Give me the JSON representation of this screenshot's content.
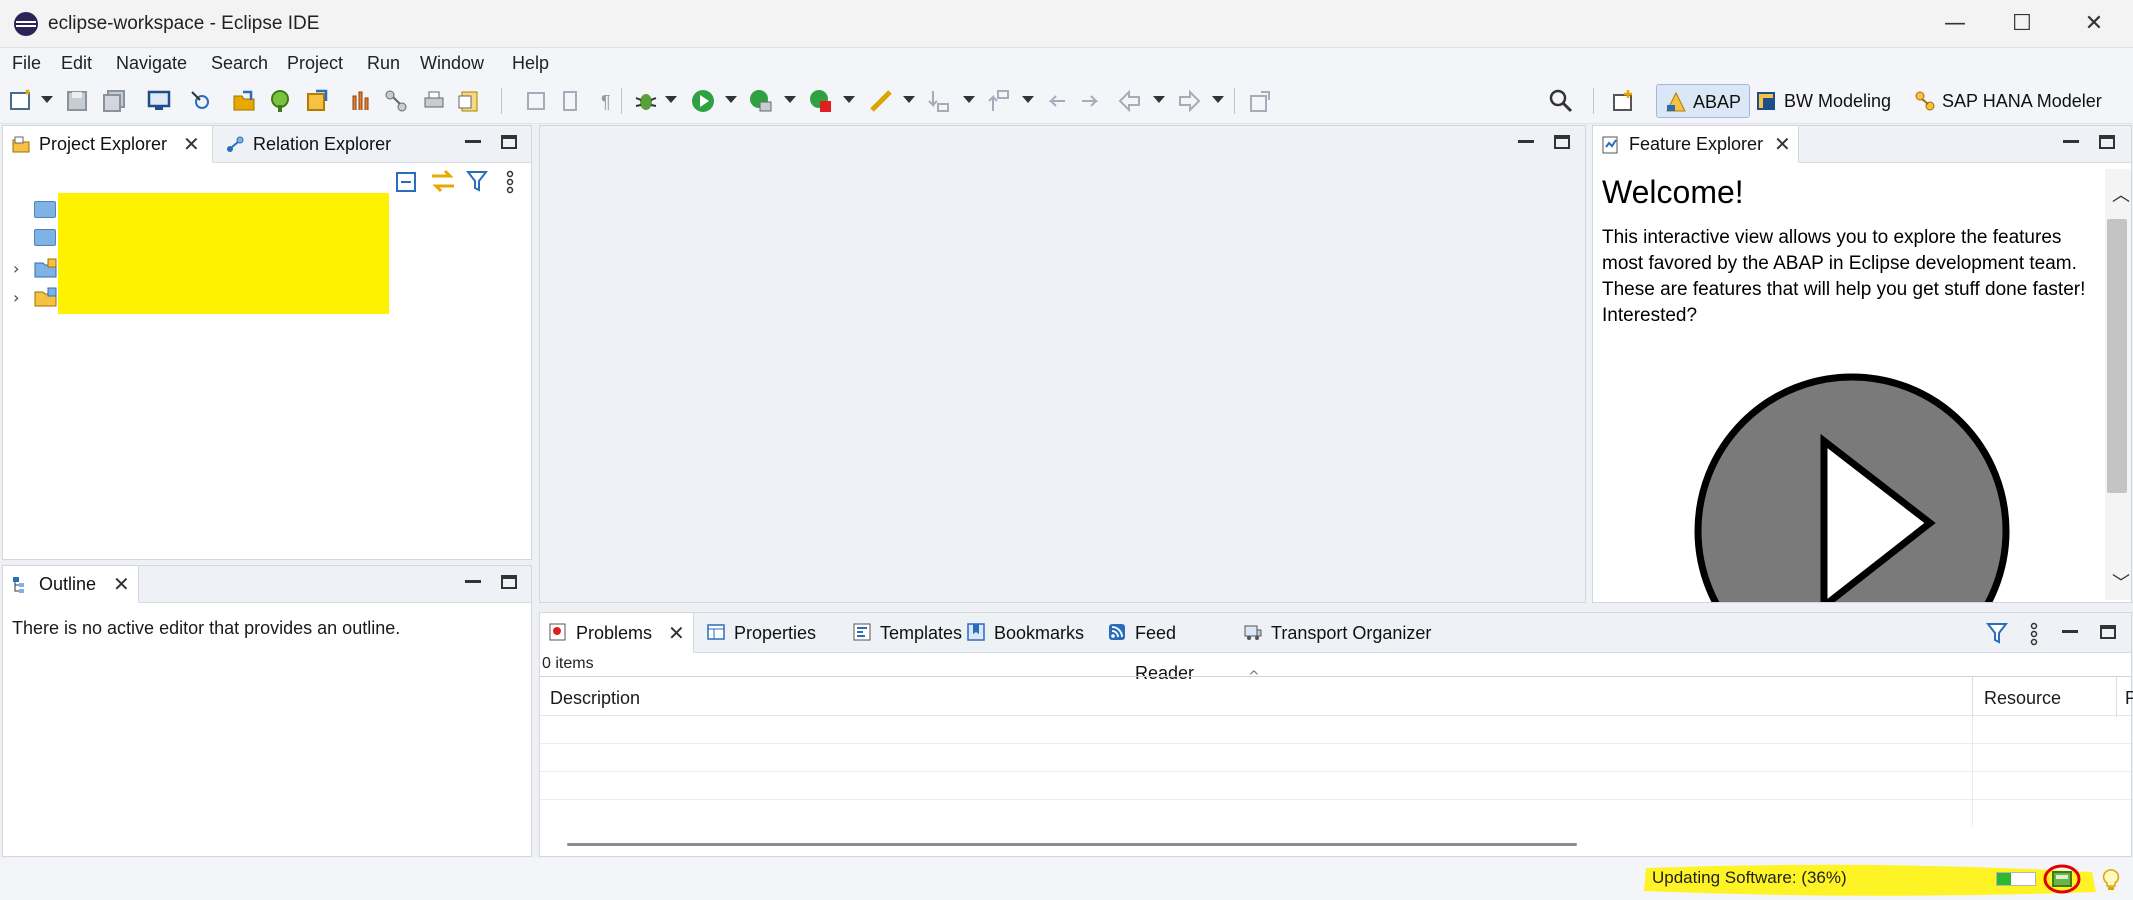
{
  "window": {
    "title": "eclipse-workspace - Eclipse IDE",
    "minimize": "—",
    "maximize": "☐",
    "close": "✕"
  },
  "menu": [
    "File",
    "Edit",
    "Navigate",
    "Search",
    "Project",
    "Run",
    "Window",
    "Help"
  ],
  "perspectives": [
    "ABAP",
    "BW Modeling",
    "SAP HANA Modeler"
  ],
  "project_explorer": {
    "tabs": [
      "Project Explorer",
      "Relation Explorer"
    ]
  },
  "outline": {
    "tab": "Outline",
    "message": "There is no active editor that provides an outline."
  },
  "feature_explorer": {
    "tab": "Feature Explorer",
    "heading": "Welcome!",
    "body": "This interactive view allows you to explore the features most favored by the ABAP in Eclipse development team. These are features that will help you get stuff done faster! Interested?"
  },
  "bottom": {
    "tabs": [
      "Problems",
      "Properties",
      "Templates",
      "Bookmarks",
      "Feed Reader",
      "Transport Organizer"
    ],
    "count": "0 items",
    "columns": [
      "Description",
      "Resource",
      "P"
    ]
  },
  "status": {
    "text": "Updating Software: (36%)",
    "progress": 0.36
  },
  "colors": {
    "highlight_yellow": "#fff200",
    "annotation_red": "#e00000",
    "progress_green": "#2db82d",
    "accent_blue": "#2a6ebb"
  }
}
